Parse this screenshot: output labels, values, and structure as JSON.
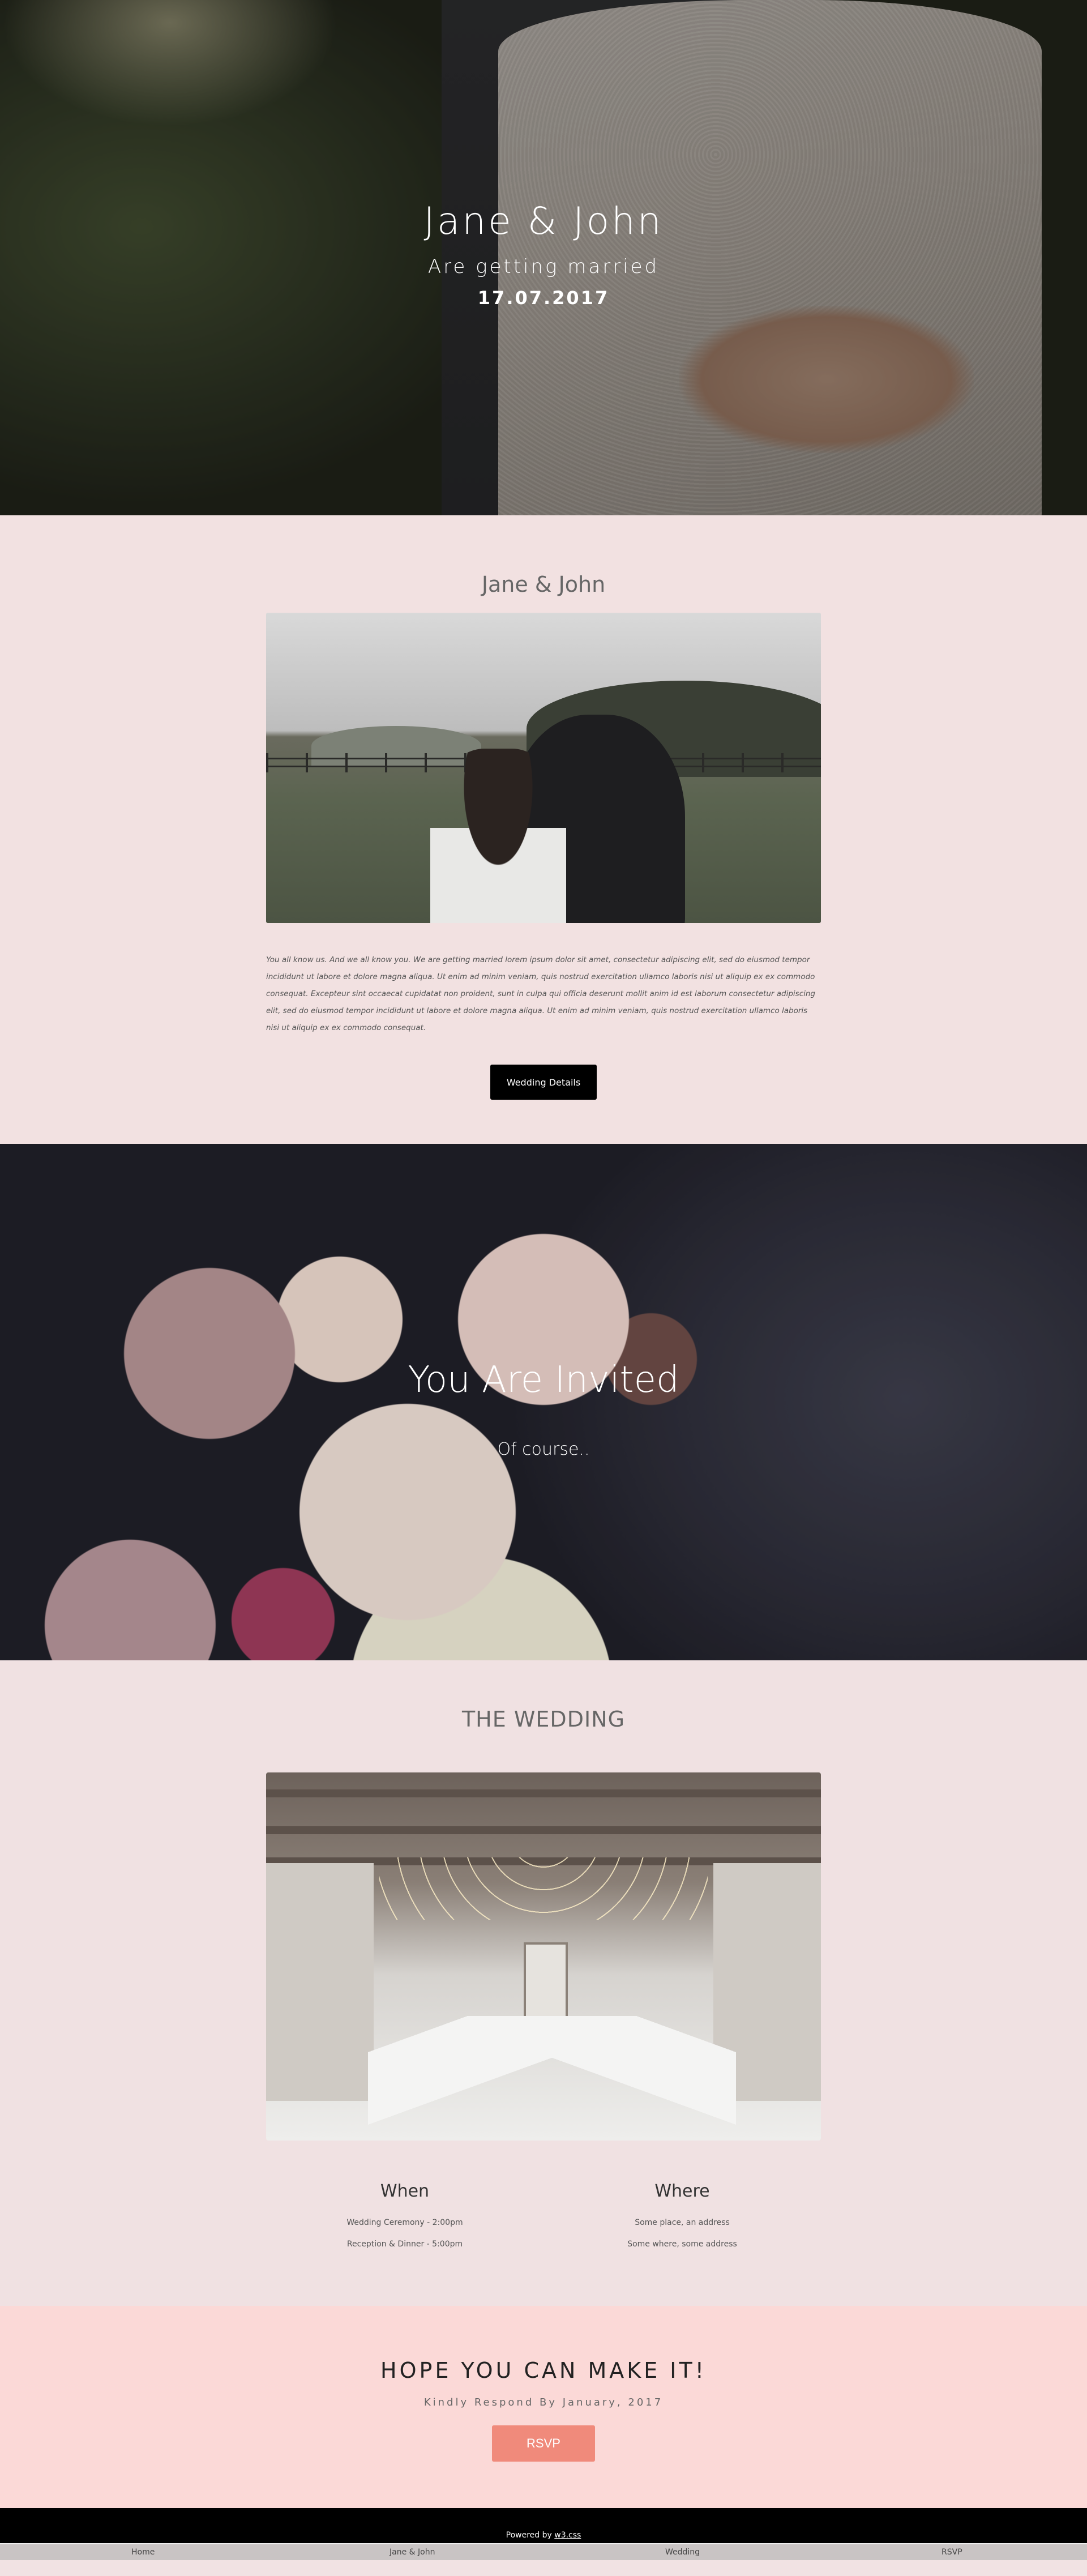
{
  "hero": {
    "title": "Jane & John",
    "subtitle": "Are getting married",
    "date": "17.07.2017"
  },
  "about": {
    "title": "Jane & John",
    "text": "You all know us. And we all know you. We are getting married lorem ipsum dolor sit amet, consectetur adipiscing elit, sed do eiusmod tempor incididunt ut labore et dolore magna aliqua. Ut enim ad minim veniam, quis nostrud exercitation ullamco laboris nisi ut aliquip ex ex commodo consequat. Excepteur sint occaecat cupidatat non proident, sunt in culpa qui officia deserunt mollit anim id est laborum consectetur adipiscing elit, sed do eiusmod tempor incididunt ut labore et dolore magna aliqua. Ut enim ad minim veniam, quis nostrud exercitation ullamco laboris nisi ut aliquip ex ex commodo consequat.",
    "button_label": "Wedding Details"
  },
  "invited": {
    "title": "You Are Invited",
    "subtitle": "Of course.."
  },
  "wedding": {
    "title": "THE WEDDING",
    "when": {
      "heading": "When",
      "lines": [
        "Wedding Ceremony - 2:00pm",
        "Reception & Dinner - 5:00pm"
      ]
    },
    "where": {
      "heading": "Where",
      "lines": [
        "Some place, an address",
        "Some where, some address"
      ]
    }
  },
  "rsvp": {
    "title": "HOPE YOU CAN MAKE IT!",
    "subtitle": "Kindly Respond By January, 2017",
    "button_label": "RSVP"
  },
  "footer": {
    "powered_prefix": "Powered by ",
    "powered_link": "w3.css"
  },
  "nav": {
    "items": [
      "Home",
      "Jane & John",
      "Wedding",
      "RSVP"
    ]
  }
}
